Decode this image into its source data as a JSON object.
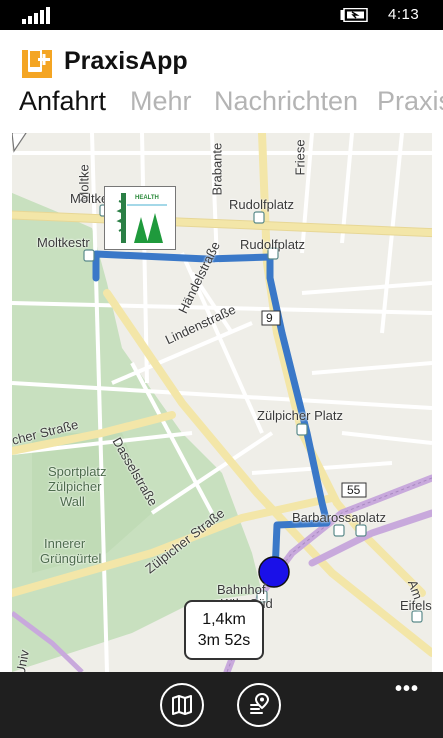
{
  "status_bar": {
    "time": "4:13",
    "signal_icon": "signal-icon",
    "battery_icon": "battery-charging-icon"
  },
  "app": {
    "title": "PraxisApp",
    "logo_icon": "praxisapp-logo-icon",
    "accent_color": "#f4a523"
  },
  "tabs": [
    {
      "label": "Anfahrt",
      "active": true
    },
    {
      "label": "Mehr",
      "active": false
    },
    {
      "label": "Nachrichten",
      "active": false
    },
    {
      "label": "Praxis",
      "active": false
    }
  ],
  "map": {
    "route_color": "#3a78c8",
    "location_color": "#1a10e8",
    "labels": {
      "moltke_top": "Moltke",
      "moltke_stop": "Moltke",
      "moltke_str": "Moltkestr",
      "brabanter": "Brabante",
      "friesen": "Friese",
      "rudolfplatz_1": "Rudolfplatz",
      "rudolfplatz_2": "Rudolfplatz",
      "haendel": "Händelstraße",
      "lindenstrasse": "Lindenstraße",
      "route_shield": "9",
      "zuelpicher_platz": "Zülpicher Platz",
      "cher_strasse": "cher Straße",
      "dasselstrasse": "Dasselstraße",
      "sportplatz_1": "Sportplatz",
      "sportplatz_2": "Zülpicher",
      "sportplatz_3": "Wall",
      "gruen_1": "Innerer",
      "gruen_2": "Grüngürtel",
      "zuelpicher_strasse": "Zülpicher Straße",
      "shield_55": "55",
      "barbarossaplatz": "Barbarossaplatz",
      "bahnhof": "Bahnhof",
      "koeln_sued": "Köln Süd",
      "eifels": "Eifels",
      "am": "Am",
      "univ": "Univ"
    },
    "pin_brand": "HEALTH",
    "route_info": {
      "distance": "1,4km",
      "duration": "3m 52s"
    }
  },
  "app_bar": {
    "buttons": [
      {
        "icon": "map-icon"
      },
      {
        "icon": "directions-pin-icon"
      }
    ],
    "more": "•••"
  }
}
